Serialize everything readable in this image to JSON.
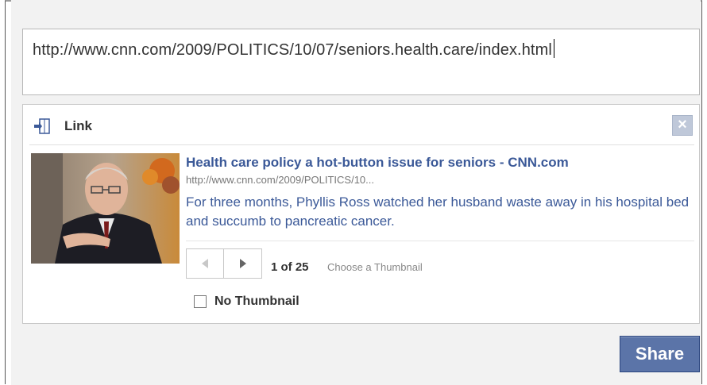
{
  "composer": {
    "url_value": "http://www.cnn.com/2009/POLITICS/10/07/seniors.health.care/index.html"
  },
  "attachment": {
    "type_label": "Link",
    "close_glyph": "×",
    "headline": "Health care policy a hot-button issue for seniors - CNN.com",
    "link_url": "http://www.cnn.com/2009/POLITICS/10...",
    "description": "For three months, Phyllis Ross watched her husband waste away in his hospital bed and succumb to pancreatic cancer.",
    "thumbnail_counter": "1 of 25",
    "choose_thumbnail_label": "Choose a Thumbnail",
    "no_thumbnail_label": "No Thumbnail",
    "no_thumbnail_checked": false
  },
  "actions": {
    "share_label": "Share"
  },
  "colors": {
    "link_blue": "#3b5998",
    "share_button_bg": "#5b74a8",
    "panel_bg": "#f2f2f2"
  },
  "icons": {
    "link": "link-icon",
    "close": "close-icon",
    "prev": "prev-arrow-icon",
    "next": "next-arrow-icon"
  }
}
